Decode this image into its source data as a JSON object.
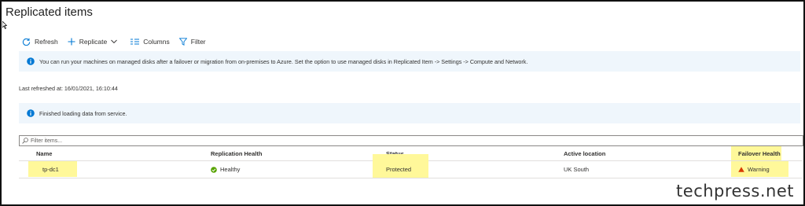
{
  "page": {
    "title": "Replicated items"
  },
  "toolbar": {
    "refresh_label": "Refresh",
    "replicate_label": "Replicate",
    "columns_label": "Columns",
    "filter_label": "Filter"
  },
  "info_banner": {
    "text": "You can run your machines on managed disks after a failover or migration from on-premises to Azure. Set the option to use managed disks in Replicated Item -> Settings -> Compute and Network."
  },
  "last_refreshed": "Last refreshed at: 16/01/2021, 16:10:44",
  "loading_banner": {
    "text": "Finished loading data from service."
  },
  "filter": {
    "placeholder": "Filter items..."
  },
  "table": {
    "columns": [
      "Name",
      "Replication Health",
      "Status",
      "Active location",
      "Failover Health"
    ],
    "rows": [
      {
        "name": "tp-dc1",
        "replication_health": "Healthy",
        "status": "Protected",
        "active_location": "UK South",
        "failover_health": "Warning"
      }
    ]
  },
  "watermark": "techpress.net",
  "colors": {
    "accent": "#0078d4",
    "highlight": "#fff89a",
    "healthy": "#57a300",
    "warning": "#d83b01",
    "banner_bg": "#eff6fc"
  }
}
